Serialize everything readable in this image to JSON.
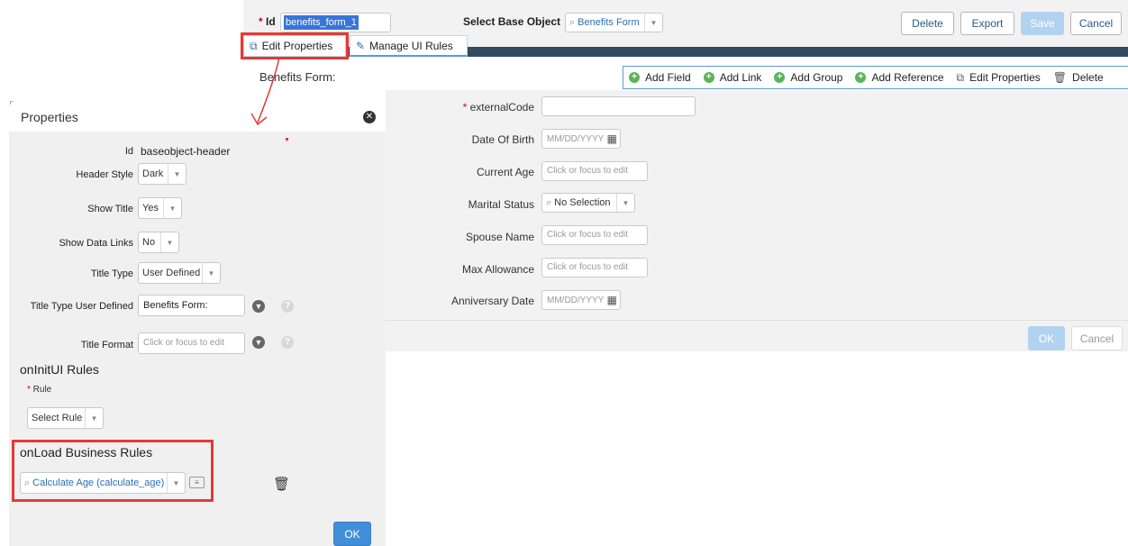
{
  "header": {
    "id_label": "Id",
    "id_value": "benefits_form_1",
    "base_object_label": "Select Base Object",
    "base_object_value": "Benefits Form",
    "buttons": {
      "delete": "Delete",
      "export": "Export",
      "save": "Save",
      "cancel": "Cancel"
    }
  },
  "tabs": {
    "edit_properties": "Edit Properties",
    "manage_ui_rules": "Manage UI Rules"
  },
  "form": {
    "title": "Benefits Form:",
    "toolbar": {
      "add_field": "Add Field",
      "add_link": "Add Link",
      "add_group": "Add Group",
      "add_reference": "Add Reference",
      "edit_properties": "Edit Properties",
      "delete": "Delete"
    },
    "fields": {
      "external_code": {
        "label": "externalCode",
        "value": ""
      },
      "dob": {
        "label": "Date Of Birth",
        "placeholder": "MM/DD/YYYY"
      },
      "current_age": {
        "label": "Current Age",
        "placeholder": "Click or focus to edit"
      },
      "marital_status": {
        "label": "Marital Status",
        "value": "No Selection"
      },
      "spouse_name": {
        "label": "Spouse Name",
        "placeholder": "Click or focus to edit"
      },
      "max_allowance": {
        "label": "Max Allowance",
        "placeholder": "Click or focus to edit"
      },
      "anniversary_date": {
        "label": "Anniversary Date",
        "placeholder": "MM/DD/YYYY"
      }
    },
    "ok": "OK",
    "cancel": "Cancel"
  },
  "properties": {
    "title": "Properties",
    "id_label": "Id",
    "id_value": "baseobject-header",
    "header_style": {
      "label": "Header Style",
      "value": "Dark"
    },
    "show_title": {
      "label": "Show Title",
      "value": "Yes"
    },
    "show_data_links": {
      "label": "Show Data Links",
      "value": "No"
    },
    "title_type": {
      "label": "Title Type",
      "value": "User Defined"
    },
    "title_type_user_defined": {
      "label": "Title Type User Defined",
      "value": "Benefits Form:"
    },
    "title_format": {
      "label": "Title Format",
      "placeholder": "Click or focus to edit"
    },
    "oninit": {
      "heading": "onInitUI Rules",
      "rule_label": "Rule",
      "rule_value": "Select Rule"
    },
    "onload": {
      "heading": "onLoad Business Rules",
      "rule_value": "Calculate Age (calculate_age)"
    },
    "ok": "OK"
  },
  "colors": {
    "accent": "#428fd9",
    "highlight": "#e53935",
    "dark_band": "#354a5f",
    "link": "#2a6fb5"
  }
}
